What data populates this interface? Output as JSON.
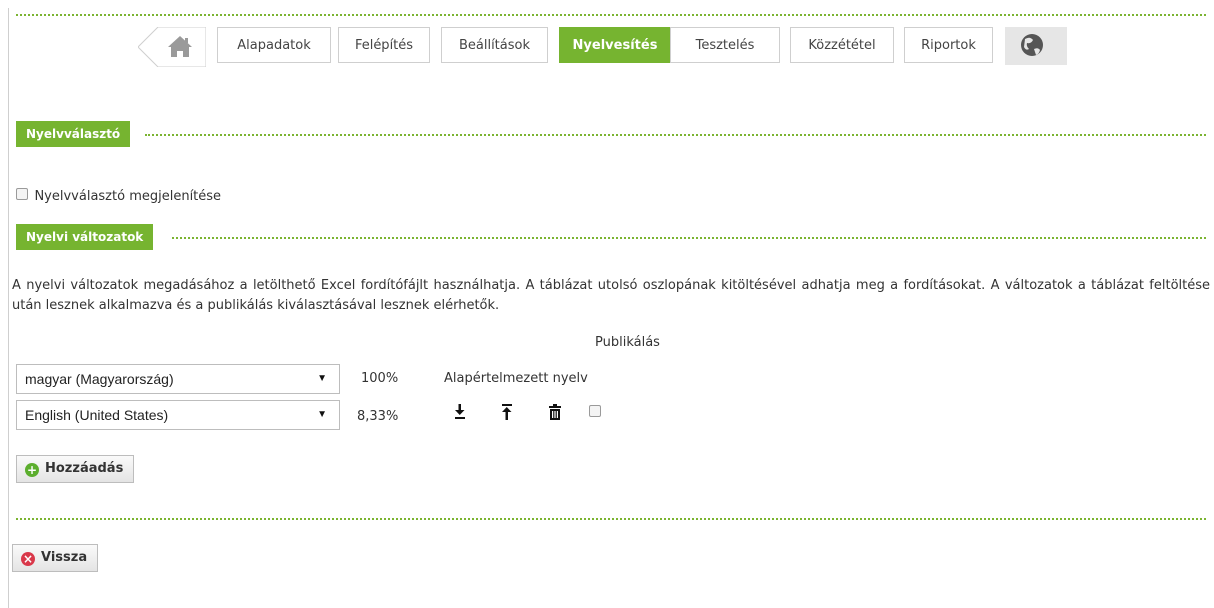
{
  "nav": {
    "tabs": [
      "Alapadatok",
      "Felépítés",
      "Beállítások",
      "Nyelvesítés",
      "Tesztelés",
      "Közzététel",
      "Riportok"
    ],
    "active_tab": "Nyelvesítés"
  },
  "section1": {
    "title": "Nyelvválasztó",
    "checkbox_label": "Nyelvválasztó megjelenítése",
    "checked": false
  },
  "section2": {
    "title": "Nyelvi változatok",
    "description": "A nyelvi változatok megadásához a letölthető Excel fordítófájlt használhatja. A táblázat utolsó oszlopának kitöltésével adhatja meg a fordításokat. A változatok a táblázat feltöltése után lesznek alkalmazva és a publikálás kiválasztásával lesznek elérhetők.",
    "column_header": "Publikálás",
    "rows": [
      {
        "language": "magyar (Magyarország)",
        "percent": "100%",
        "note": "Alapértelmezett nyelv"
      },
      {
        "language": "English (United States)",
        "percent": "8,33%",
        "publish": false
      }
    ],
    "add_button": "Hozzáadás"
  },
  "back_button": "Vissza",
  "colors": {
    "accent": "#76b430",
    "add_icon": "#5cae2e",
    "back_icon": "#d9384a"
  }
}
